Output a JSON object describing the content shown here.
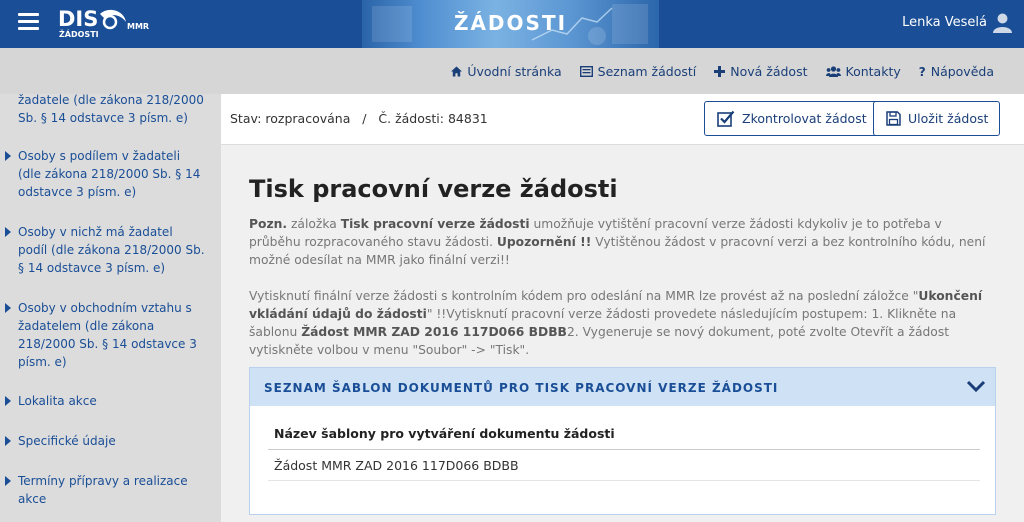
{
  "header": {
    "logo_main": "DIS",
    "logo_sub": "ŽÁDOSTI",
    "logo_mmr": "MMR",
    "banner_title": "ŽÁDOSTI",
    "user_name": "Lenka Veselá",
    "color": "#1a4e96"
  },
  "topnav": {
    "items": [
      {
        "label": "Úvodní stránka",
        "icon": "home-icon"
      },
      {
        "label": "Seznam žádostí",
        "icon": "list-icon"
      },
      {
        "label": "Nová žádost",
        "icon": "plus-icon"
      },
      {
        "label": "Kontakty",
        "icon": "users-icon"
      },
      {
        "label": "Nápověda",
        "icon": "question-icon"
      }
    ]
  },
  "sidebar": {
    "items": [
      {
        "label": "žadatele (dle zákona 218/2000 Sb. § 14 odstavce 3 písm. e)"
      },
      {
        "label": "Osoby s podílem v žadateli (dle zákona 218/2000 Sb. § 14 odstavce 3 písm. e)"
      },
      {
        "label": "Osoby v nichž má žadatel podíl (dle zákona 218/2000 Sb. § 14 odstavce 3 písm. e)"
      },
      {
        "label": "Osoby v obchodním vztahu s žadatelem (dle zákona 218/2000 Sb. § 14 odstavce 3 písm. e)"
      },
      {
        "label": "Lokalita akce"
      },
      {
        "label": "Specifické údaje"
      },
      {
        "label": "Termíny přípravy a realizace akce"
      }
    ]
  },
  "statusbar": {
    "status_text": "Stav: rozpracována   /   Č. žádosti: 84831",
    "check_button": "Zkontrolovat žádost",
    "save_button": "Uložit žádost"
  },
  "main": {
    "title": "Tisk pracovní verze žádosti",
    "para1": {
      "p1": "Pozn.",
      "p2": " záložka ",
      "p3": "Tisk pracovní verze žádosti",
      "p4": " umožňuje vytištění pracovní verze žádosti kdykoliv je to potřeba v průběhu rozpracovaného stavu žádosti. ",
      "p5": "Upozornění !!",
      "p6": " Vytištěnou žádost v pracovní verzi a bez kontrolního kódu, není možné odesílat na MMR jako finální verzi!!"
    },
    "para2": {
      "p1": "Vytisknutí finální verze žádosti s kontrolním kódem pro odeslání na MMR lze provést až na poslední záložce \"",
      "p2": "Ukončení vkládání údajů do žádosti",
      "p3": "\" !!Vytisknutí pracovní verze žádosti provedete následujícím postupem: 1. Klikněte na šablonu ",
      "p4": "Žádost MMR ZAD 2016 117D066 BDBB",
      "p5": "2. Vygeneruje se nový dokument, poté zvolte Otevřít a žádost vytiskněte volbou v menu \"Soubor\" -> \"Tisk\"."
    },
    "panel": {
      "title": "SEZNAM ŠABLON DOKUMENTŮ PRO TISK PRACOVNÍ VERZE ŽÁDOSTI",
      "column_header": "Název šablony pro vytváření dokumentu žádosti",
      "rows": [
        "Žádost MMR ZAD 2016 117D066 BDBB"
      ]
    }
  }
}
